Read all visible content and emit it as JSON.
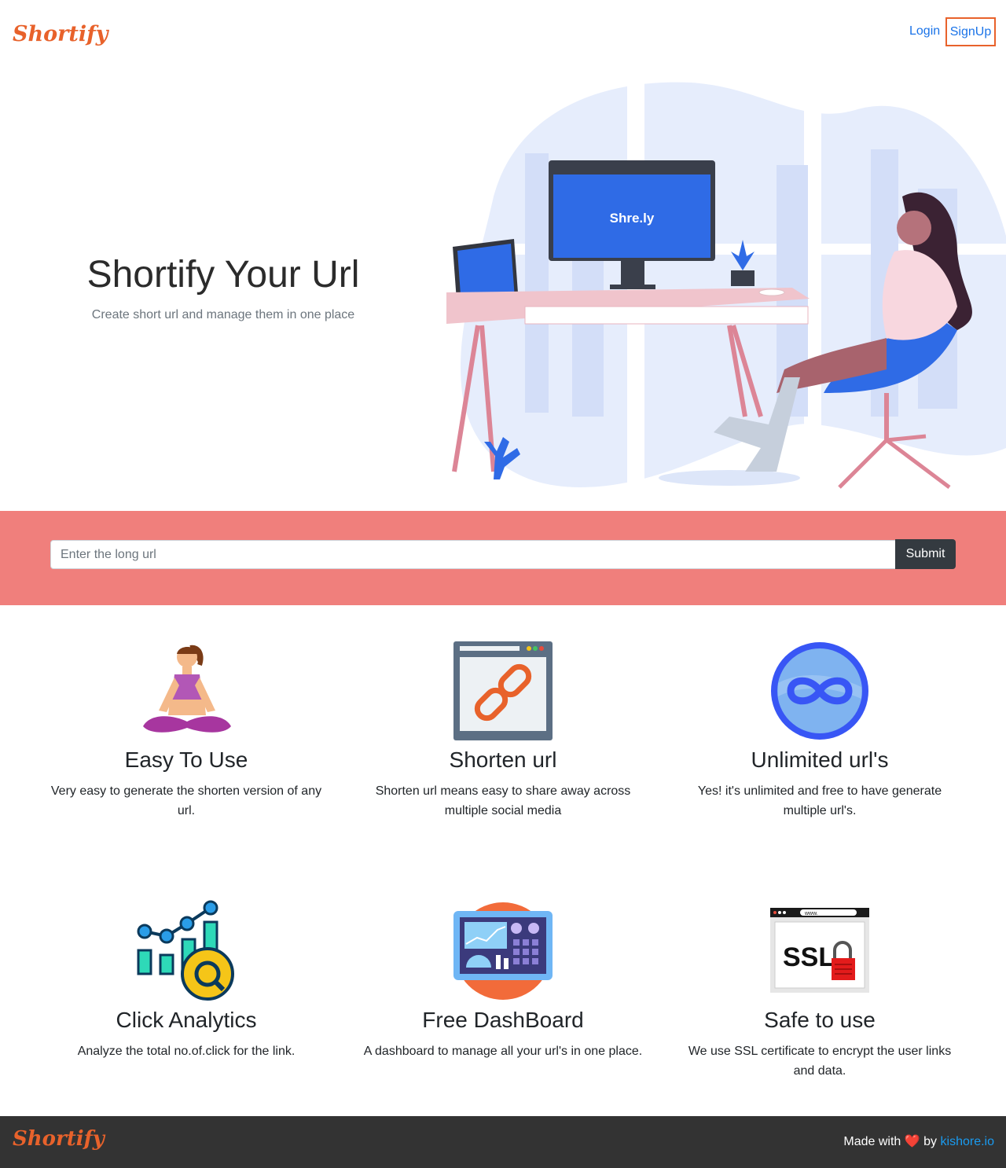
{
  "nav": {
    "brand": "Shortify",
    "login_label": "Login",
    "signup_label": "SignUp"
  },
  "hero": {
    "title": "Shortify Your Url",
    "subtitle": "Create short url and manage them in one place",
    "monitor_text": "Shre.ly"
  },
  "shortener": {
    "input_placeholder": "Enter the long url",
    "input_value": "",
    "submit_label": "Submit"
  },
  "features": [
    {
      "icon": "yoga-icon",
      "title": "Easy To Use",
      "desc": "Very easy to generate the shorten version of any url."
    },
    {
      "icon": "link-icon",
      "title": "Shorten url",
      "desc": "Shorten url means easy to share away across multiple social media"
    },
    {
      "icon": "infinity-icon",
      "title": "Unlimited url's",
      "desc": "Yes! it's unlimited and free to have generate multiple url's."
    },
    {
      "icon": "analytics-icon",
      "title": "Click Analytics",
      "desc": "Analyze the total no.of.click for the link."
    },
    {
      "icon": "dashboard-icon",
      "title": "Free DashBoard",
      "desc": "A dashboard to manage all your url's in one place."
    },
    {
      "icon": "ssl-icon",
      "title": "Safe to use",
      "desc": "We use SSL certificate to encrypt the user links and data.",
      "ssl_text": "SSL",
      "url_bar_text": "www."
    }
  ],
  "footer": {
    "brand": "Shortify",
    "made_with": "Made with",
    "heart": "❤️",
    "by": "by",
    "author_link": "kishore.io"
  },
  "colors": {
    "brand_orange": "#e8622b",
    "link_blue": "#1a73e8",
    "strip_coral": "#f07f7c",
    "dark_button": "#343a40",
    "footer_bg": "#333333"
  }
}
